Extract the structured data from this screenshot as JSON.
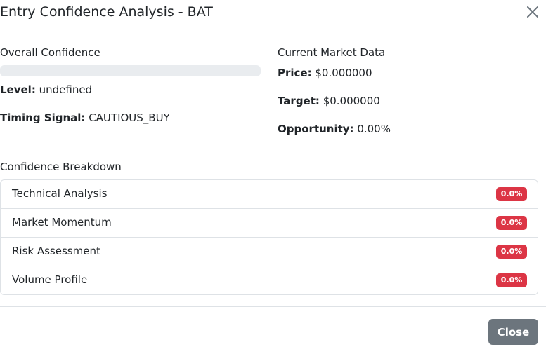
{
  "header": {
    "title": "Entry Confidence Analysis - BAT",
    "close_icon": "close-icon"
  },
  "overall": {
    "title": "Overall Confidence",
    "progress_percent": 0,
    "level_label": "Level:",
    "level_value": "undefined",
    "timing_label": "Timing Signal:",
    "timing_value": "CAUTIOUS_BUY"
  },
  "market": {
    "title": "Current Market Data",
    "price_label": "Price:",
    "price_value": "$0.000000",
    "target_label": "Target:",
    "target_value": "$0.000000",
    "opportunity_label": "Opportunity:",
    "opportunity_value": "0.00%"
  },
  "breakdown": {
    "title": "Confidence Breakdown",
    "items": [
      {
        "label": "Technical Analysis",
        "value": "0.0%"
      },
      {
        "label": "Market Momentum",
        "value": "0.0%"
      },
      {
        "label": "Risk Assessment",
        "value": "0.0%"
      },
      {
        "label": "Volume Profile",
        "value": "0.0%"
      }
    ]
  },
  "footer": {
    "close_label": "Close"
  },
  "colors": {
    "badge_danger": "#dc3545",
    "button_secondary": "#6c757d",
    "progress_track": "#e9ecef",
    "border": "#dee2e6"
  }
}
